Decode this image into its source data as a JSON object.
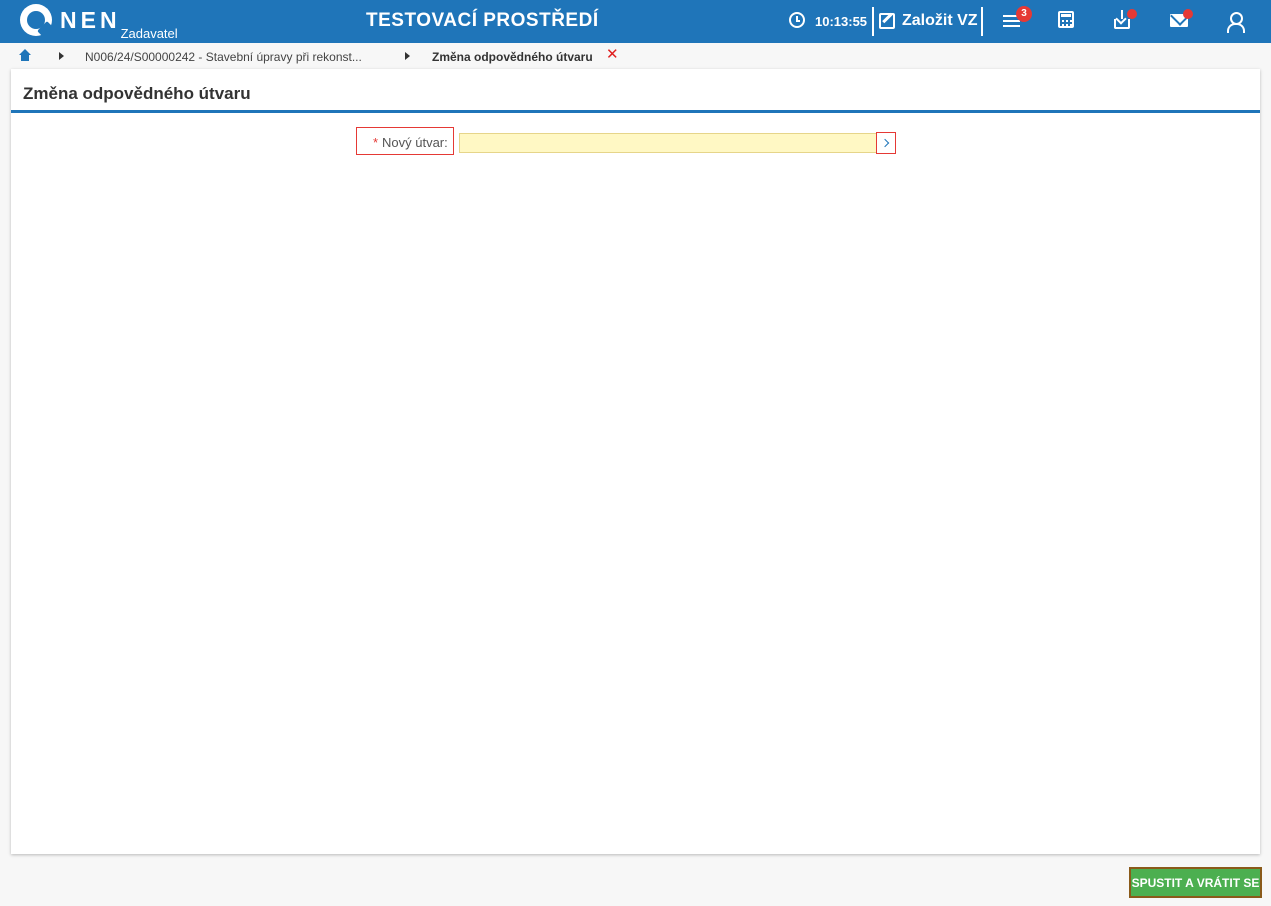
{
  "header": {
    "logo_text": "NEN",
    "logo_subtitle": "Zadavatel",
    "environment_title": "TESTOVACÍ PROSTŘEDÍ",
    "time": "10:13:55",
    "create_label": "Založit VZ",
    "tasks_badge": "3",
    "accent_color": "#1f75b9",
    "badge_color": "#e53935"
  },
  "breadcrumb": {
    "home_icon": "home-icon",
    "items": [
      {
        "label": "N006/24/S00000242 - Stavební úpravy při rekonst..."
      },
      {
        "label": "Změna odpovědného útvaru"
      }
    ],
    "close_symbol": "✕"
  },
  "main": {
    "title": "Změna odpovědného útvaru",
    "form": {
      "field_required_marker": "*",
      "field_label": "Nový útvar:",
      "field_value": ""
    }
  },
  "footer": {
    "run_button_label": "SPUSTIT A VRÁTIT SE"
  }
}
